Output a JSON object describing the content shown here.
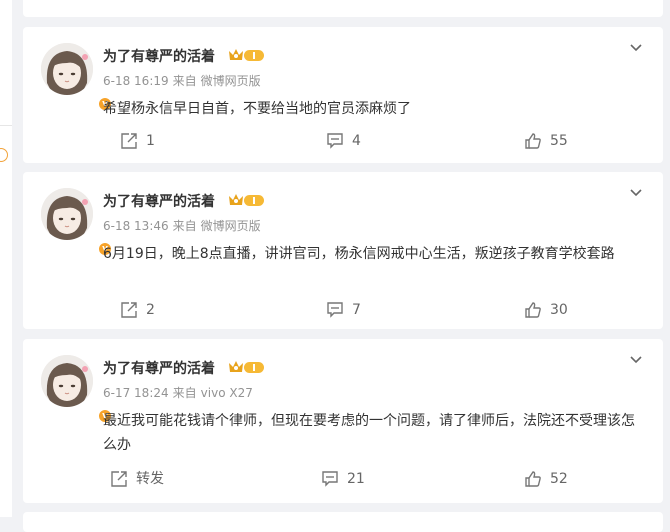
{
  "comments": [
    {
      "username": "为了有尊严的活着",
      "date": "6-18 16:19",
      "source_prefix": "来自",
      "source": "微博网页版",
      "text": "希望杨永信早日自首，不要给当地的官员添麻烦了",
      "reposts": "1",
      "comments": "4",
      "likes": "55"
    },
    {
      "username": "为了有尊严的活着",
      "date": "6-18 13:46",
      "source_prefix": "来自",
      "source": "微博网页版",
      "text": "6月19日，晚上8点直播，讲讲官司，杨永信网戒中心生活，叛逆孩子教育学校套路",
      "reposts": "2",
      "comments": "7",
      "likes": "30"
    },
    {
      "username": "为了有尊严的活着",
      "date": "6-17 18:24",
      "source_prefix": "来自",
      "source": "vivo X27",
      "text": "最近我可能花钱请个律师，但现在要考虑的一个问题，请了律师后，法院还不受理该怎么办",
      "reposts": "转发",
      "comments": "21",
      "likes": "52"
    }
  ],
  "colors": {
    "background": "#f1f2f5",
    "verified": "#f7a32a",
    "meta_text": "#939393",
    "action_text": "#666666"
  },
  "icons": {
    "repost": "repost-icon",
    "comment": "comment-icon",
    "like": "like-icon",
    "more": "chevron-down-icon",
    "verified": "verified-badge-icon",
    "vip": "vip-crown-icon"
  }
}
